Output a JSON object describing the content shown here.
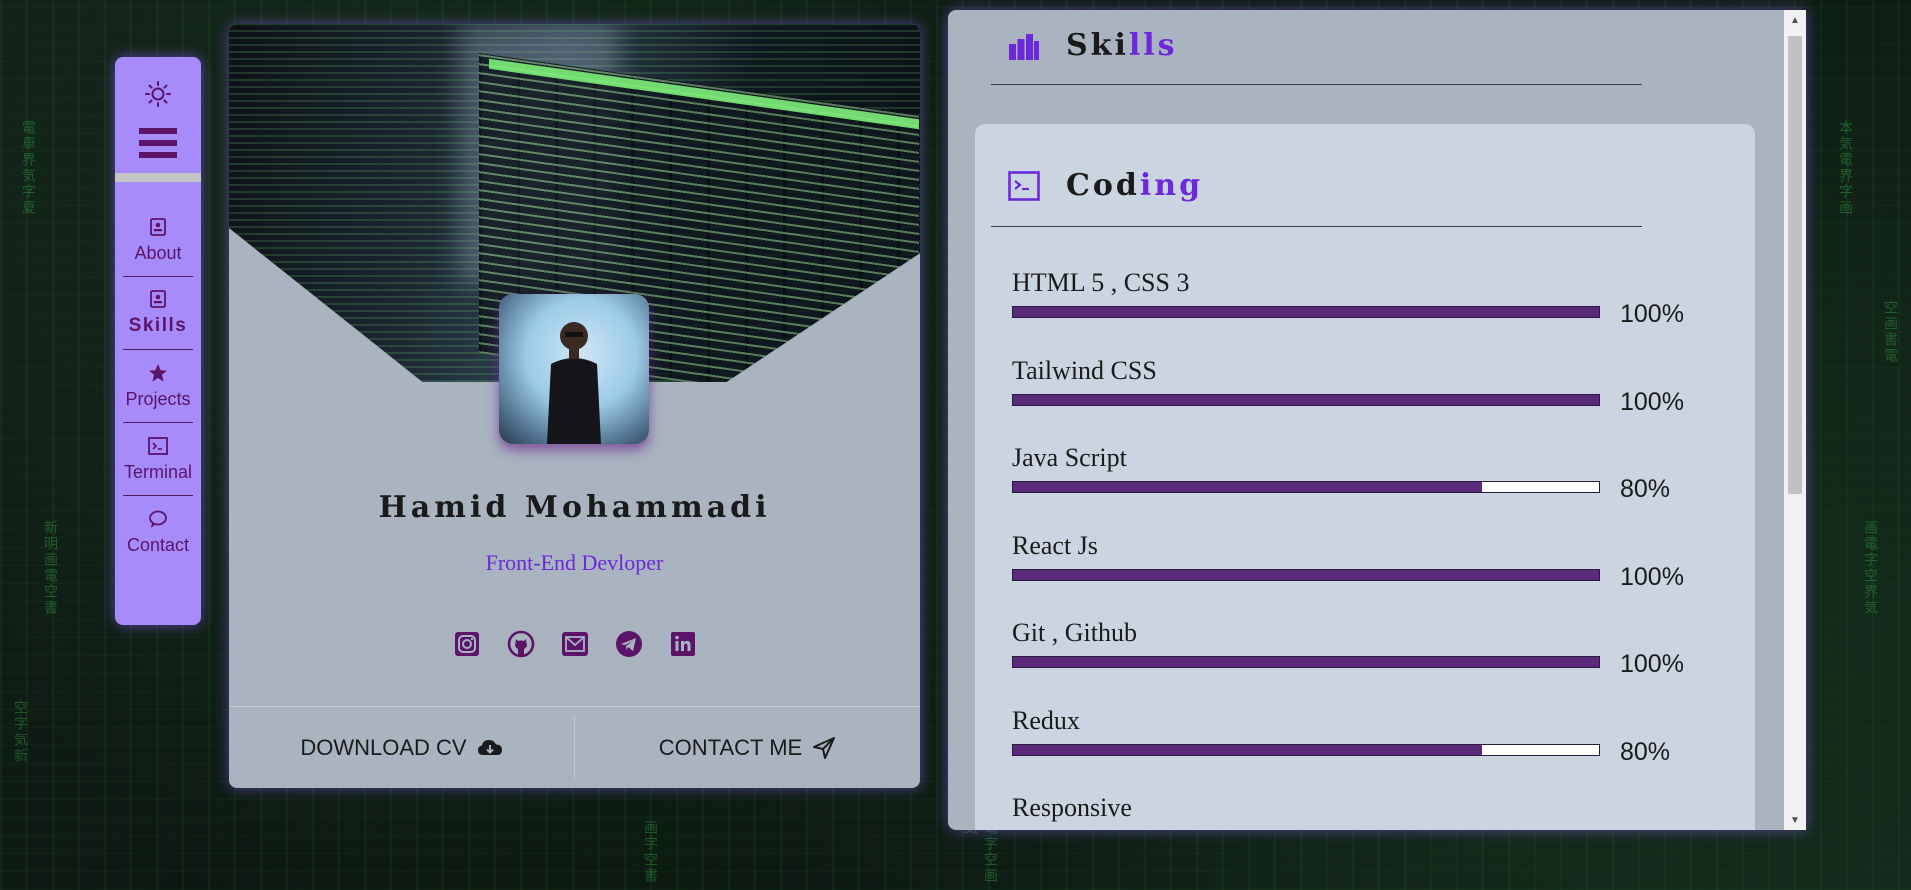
{
  "sidebar": {
    "items": [
      {
        "label": "About",
        "icon": "profile-icon"
      },
      {
        "label": "Skills",
        "icon": "profile-icon"
      },
      {
        "label": "Projects",
        "icon": "star-icon"
      },
      {
        "label": "Terminal",
        "icon": "terminal-icon"
      },
      {
        "label": "Contact",
        "icon": "chat-icon"
      }
    ],
    "active": "Skills",
    "theme_icon": "sun-icon",
    "menu_icon": "hamburger-icon"
  },
  "profile": {
    "name": "Hamid Mohammadi",
    "role": "Front-End Devloper",
    "socials": [
      "instagram-icon",
      "github-icon",
      "email-icon",
      "telegram-icon",
      "linkedin-icon"
    ],
    "download_label": "DOWNLOAD CV",
    "contact_label": "CONTACT ME"
  },
  "skills_panel": {
    "title_start": "Ski",
    "title_accent": "lls",
    "coding": {
      "title_start": "Cod",
      "title_accent": "ing",
      "items": [
        {
          "name": "HTML 5 , CSS 3",
          "percent": "100%",
          "level": 100
        },
        {
          "name": "Tailwind CSS",
          "percent": "100%",
          "level": 100
        },
        {
          "name": "Java Script",
          "percent": "80%",
          "level": 80
        },
        {
          "name": "React Js",
          "percent": "100%",
          "level": 100
        },
        {
          "name": "Git , Github",
          "percent": "100%",
          "level": 100
        },
        {
          "name": "Redux",
          "percent": "80%",
          "level": 80
        },
        {
          "name": "Responsive",
          "percent": "",
          "level": null
        }
      ]
    }
  },
  "colors": {
    "accent": "#6d28d9",
    "sidebar": "#a78bfa",
    "bar_fill": "#5b2a7a",
    "panel": "#a9b4c0"
  }
}
